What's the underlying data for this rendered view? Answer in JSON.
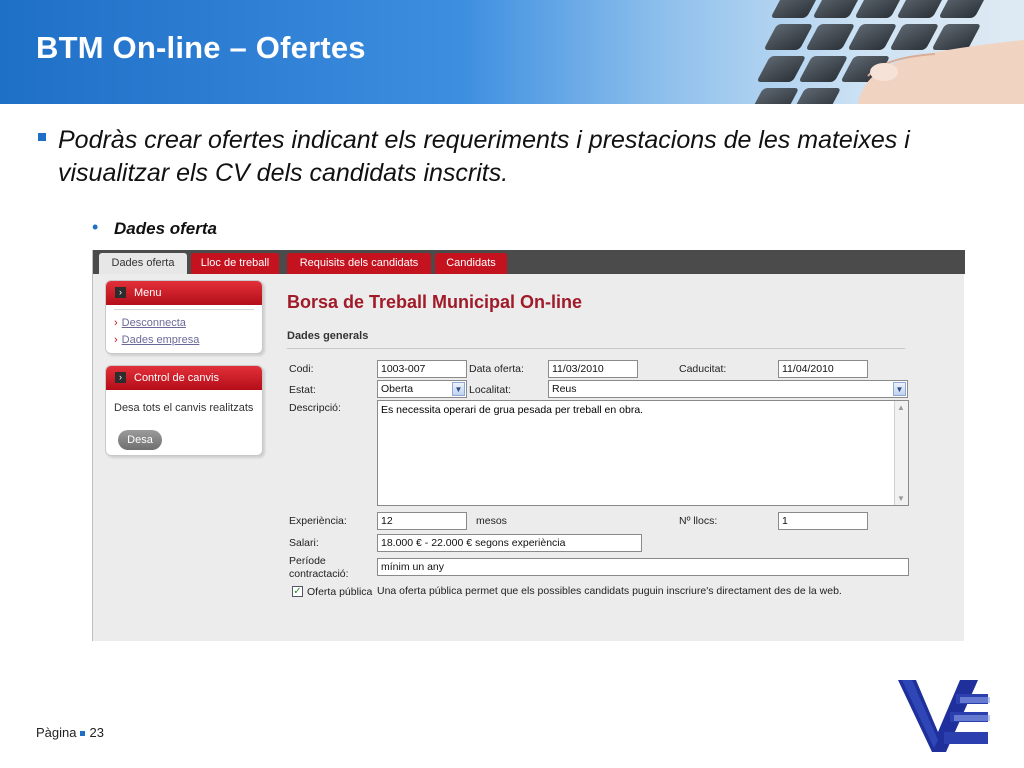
{
  "slide": {
    "title": "BTM On-line – Ofertes",
    "bullet1": "Podràs crear ofertes indicant els requeriments i prestacions de les mateixes i visualitzar els CV dels candidats inscrits.",
    "bullet2": "Dades oferta",
    "page_label": "Pàgina",
    "page_number": "23"
  },
  "app": {
    "tabs": [
      {
        "label": "Dades oferta",
        "active": true
      },
      {
        "label": "Lloc de treball",
        "active": false
      },
      {
        "label": "Requisits dels candidats",
        "active": false
      },
      {
        "label": "Candidats",
        "active": false
      }
    ],
    "menu_panel": {
      "title": "Menu",
      "links": [
        "Desconnecta",
        "Dades empresa"
      ]
    },
    "control_panel": {
      "title": "Control de canvis",
      "text": "Desa tots el canvis realitzats",
      "button": "Desa"
    },
    "main_title": "Borsa de Treball Municipal On-line",
    "section_title": "Dades generals",
    "form": {
      "codi_label": "Codi:",
      "codi_value": "1003-007",
      "data_oferta_label": "Data oferta:",
      "data_oferta_value": "11/03/2010",
      "caducitat_label": "Caducitat:",
      "caducitat_value": "11/04/2010",
      "estat_label": "Estat:",
      "estat_value": "Oberta",
      "localitat_label": "Localitat:",
      "localitat_value": "Reus",
      "descripcio_label": "Descripció:",
      "descripcio_value": "Es necessita operari de grua pesada per treball en obra.",
      "experiencia_label": "Experiència:",
      "experiencia_value": "12",
      "experiencia_unit": "mesos",
      "n_llocs_label": "Nº llocs:",
      "n_llocs_value": "1",
      "salari_label": "Salari:",
      "salari_value": "18.000 € - 22.000 € segons experiència",
      "periode_label_1": "Període",
      "periode_label_2": "contractació:",
      "periode_value": "mínim un any",
      "oferta_publica_label": "Oferta pública",
      "oferta_publica_checked": true,
      "oferta_publica_hint": "Una oferta pública permet que els possibles candidats puguin inscriure's directament des de la web."
    }
  },
  "colors": {
    "brand_blue": "#1e6fc6",
    "tab_red": "#c4121f",
    "title_red": "#a01a28"
  }
}
